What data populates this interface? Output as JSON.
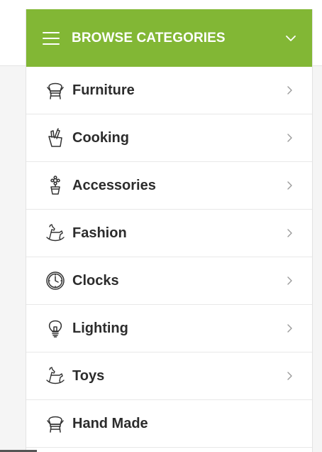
{
  "menu": {
    "title": "BROWSE CATEGORIES",
    "accent_color": "#82b735",
    "header_icon": "hamburger-icon",
    "toggle_icon": "chevron-down-icon",
    "items": [
      {
        "label": "Furniture",
        "icon": "chair-icon",
        "has_submenu": true
      },
      {
        "label": "Cooking",
        "icon": "knife-block-icon",
        "has_submenu": true
      },
      {
        "label": "Accessories",
        "icon": "flower-pot-icon",
        "has_submenu": true
      },
      {
        "label": "Fashion",
        "icon": "rocking-horse-icon",
        "has_submenu": true
      },
      {
        "label": "Clocks",
        "icon": "clock-icon",
        "has_submenu": true
      },
      {
        "label": "Lighting",
        "icon": "light-bulb-icon",
        "has_submenu": true
      },
      {
        "label": "Toys",
        "icon": "rocking-horse-icon",
        "has_submenu": true
      },
      {
        "label": "Hand Made",
        "icon": "chair-icon",
        "has_submenu": false
      }
    ]
  }
}
